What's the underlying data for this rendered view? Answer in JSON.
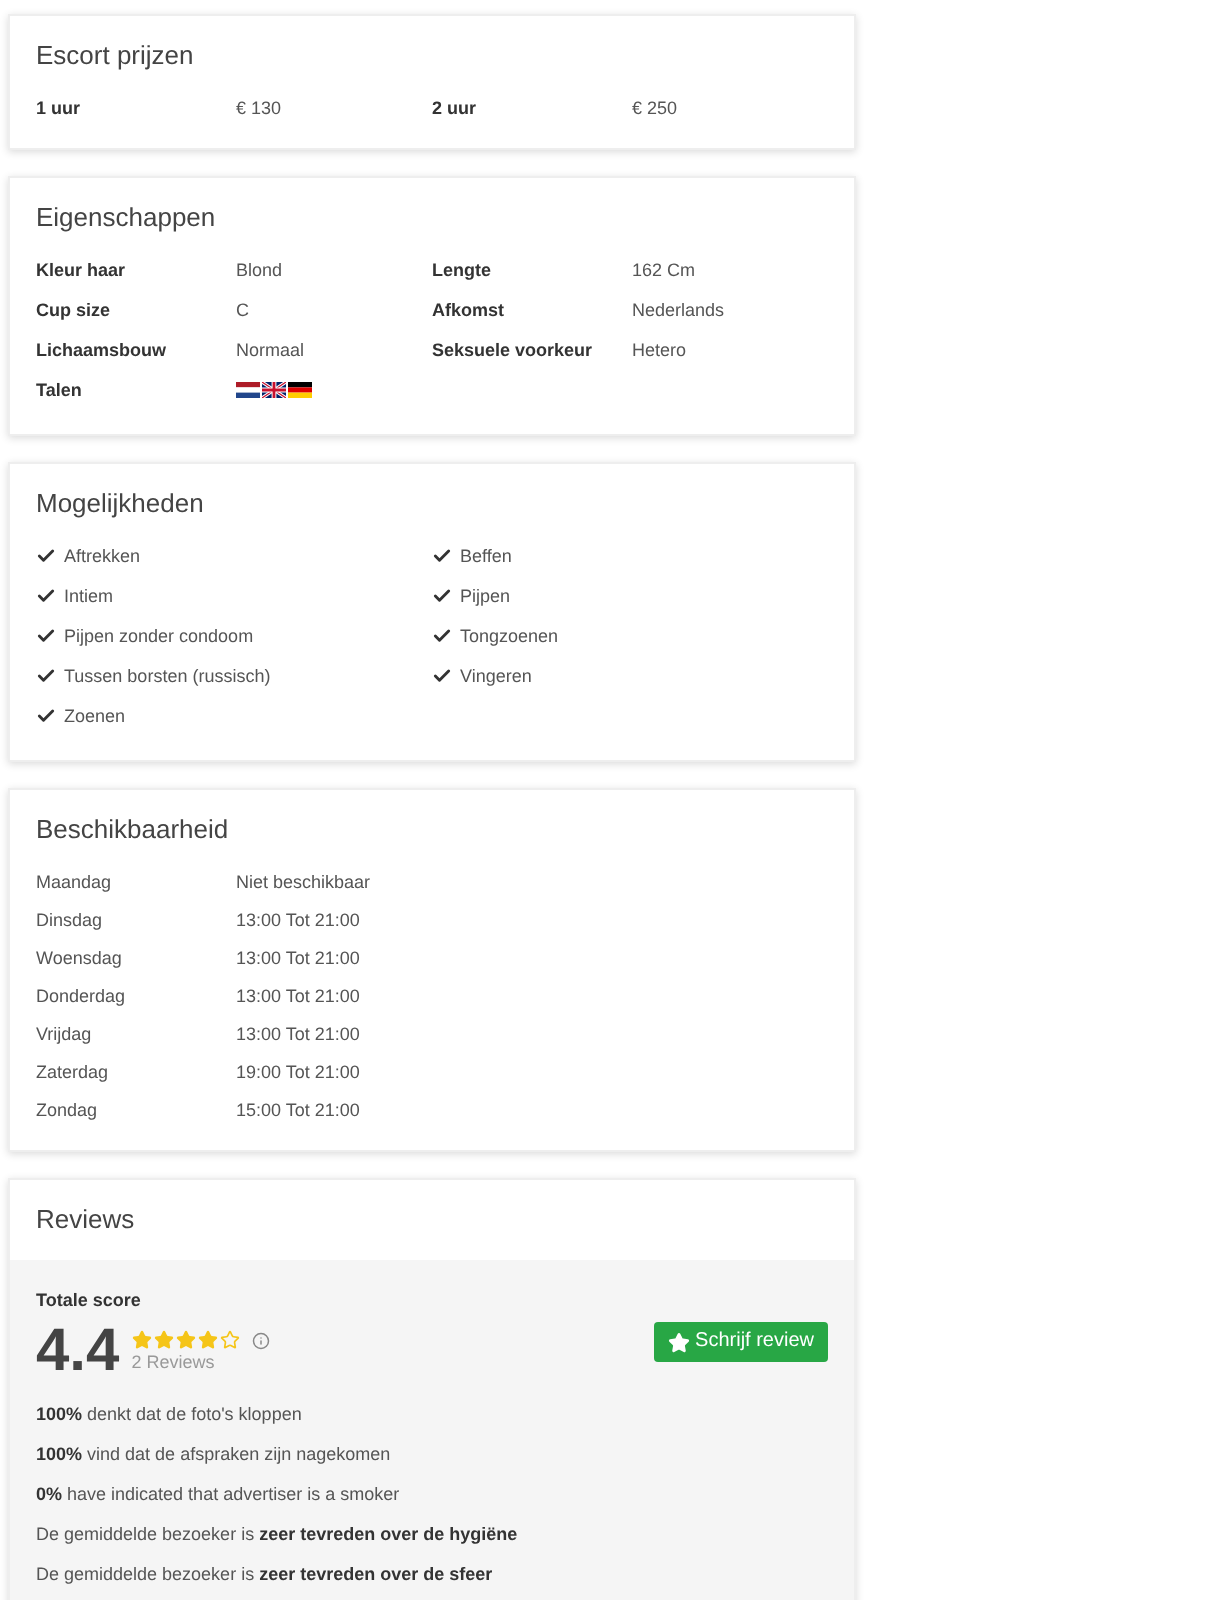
{
  "prices": {
    "title": "Escort prijzen",
    "items": [
      {
        "label": "1 uur",
        "value": "€ 130"
      },
      {
        "label": "2 uur",
        "value": "€ 250"
      }
    ]
  },
  "properties": {
    "title": "Eigenschappen",
    "items": [
      {
        "label": "Kleur haar",
        "value": "Blond"
      },
      {
        "label": "Lengte",
        "value": "162 Cm"
      },
      {
        "label": "Cup size",
        "value": "C"
      },
      {
        "label": "Afkomst",
        "value": "Nederlands"
      },
      {
        "label": "Lichaamsbouw",
        "value": "Normaal"
      },
      {
        "label": "Seksuele voorkeur",
        "value": "Hetero"
      }
    ],
    "languages_label": "Talen",
    "languages": [
      {
        "kind": "nl"
      },
      {
        "kind": "gb"
      },
      {
        "kind": "de"
      }
    ]
  },
  "options": {
    "title": "Mogelijkheden",
    "items": [
      {
        "label": "Aftrekken",
        "checked": true
      },
      {
        "label": "Beffen",
        "checked": true
      },
      {
        "label": "Intiem",
        "checked": true
      },
      {
        "label": "Pijpen",
        "checked": true
      },
      {
        "label": "Pijpen zonder condoom",
        "checked": true
      },
      {
        "label": "Tongzoenen",
        "checked": true
      },
      {
        "label": "Tussen borsten (russisch)",
        "checked": true
      },
      {
        "label": "Vingeren",
        "checked": true
      },
      {
        "label": "Zoenen",
        "checked": true
      }
    ]
  },
  "availability": {
    "title": "Beschikbaarheid",
    "rows": [
      {
        "day": "Maandag",
        "hours": "Niet beschikbaar"
      },
      {
        "day": "Dinsdag",
        "hours": "13:00 Tot 21:00"
      },
      {
        "day": "Woensdag",
        "hours": "13:00 Tot 21:00"
      },
      {
        "day": "Donderdag",
        "hours": "13:00 Tot 21:00"
      },
      {
        "day": "Vrijdag",
        "hours": "13:00 Tot 21:00"
      },
      {
        "day": "Zaterdag",
        "hours": "19:00 Tot 21:00"
      },
      {
        "day": "Zondag",
        "hours": "15:00 Tot 21:00"
      }
    ]
  },
  "reviews": {
    "title": "Reviews",
    "total_label": "Totale score",
    "score": "4.4",
    "stars": 4,
    "count": "2 Reviews",
    "write_button": "Schrijf review",
    "stats": [
      "**100%** denkt dat de foto's kloppen",
      "**100%** vind dat de afspraken zijn nagekomen",
      "**0%** have indicated that advertiser is a smoker",
      "De gemiddelde bezoeker is **zeer tevreden over de hygiëne**",
      "De gemiddelde bezoeker is **zeer tevreden over de sfeer**"
    ]
  }
}
